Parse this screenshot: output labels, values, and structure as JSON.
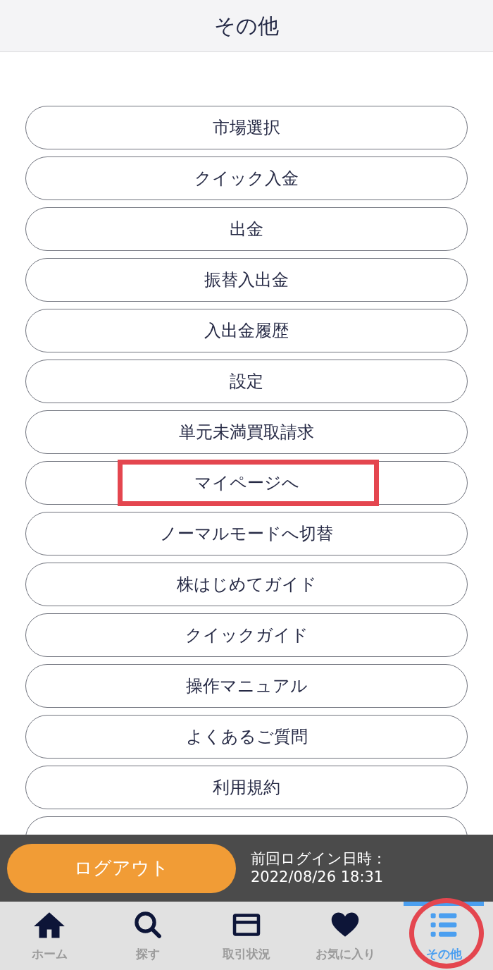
{
  "header": {
    "title": "その他"
  },
  "menu": [
    {
      "label": "市場選択",
      "marked": false
    },
    {
      "label": "クイック入金",
      "marked": false
    },
    {
      "label": "出金",
      "marked": false
    },
    {
      "label": "振替入出金",
      "marked": false
    },
    {
      "label": "入出金履歴",
      "marked": false
    },
    {
      "label": "設定",
      "marked": false
    },
    {
      "label": "単元未満買取請求",
      "marked": false
    },
    {
      "label": "マイページへ",
      "marked": true
    },
    {
      "label": "ノーマルモードへ切替",
      "marked": false
    },
    {
      "label": "株はじめてガイド",
      "marked": false
    },
    {
      "label": "クイックガイド",
      "marked": false
    },
    {
      "label": "操作マニュアル",
      "marked": false
    },
    {
      "label": "よくあるご質問",
      "marked": false
    },
    {
      "label": "利用規約",
      "marked": false
    },
    {
      "marked": false
    }
  ],
  "logout_bar": {
    "button": "ログアウト",
    "last_login_label": "前回ログイン日時：",
    "last_login_time": "2022/08/26 18:31"
  },
  "tabs": [
    {
      "kind": "home",
      "label": "ホーム",
      "selected": false,
      "marked": false
    },
    {
      "kind": "search",
      "label": "探す",
      "selected": false,
      "marked": false
    },
    {
      "kind": "card",
      "label": "取引状況",
      "selected": false,
      "marked": false
    },
    {
      "kind": "heart",
      "label": "お気に入り",
      "selected": false,
      "marked": false
    },
    {
      "kind": "list",
      "label": "その他",
      "selected": true,
      "marked": true
    }
  ]
}
